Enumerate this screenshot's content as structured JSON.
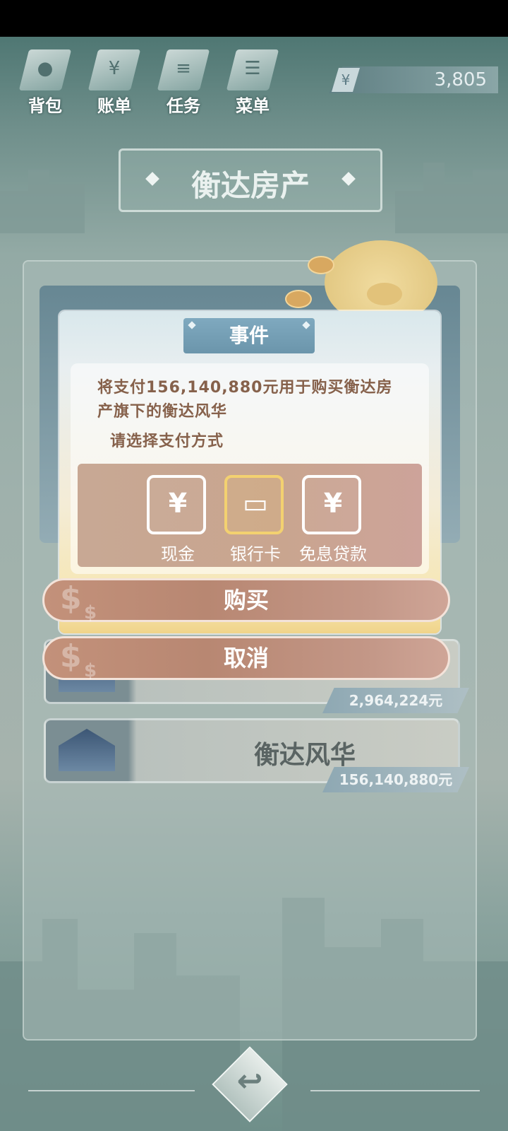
{
  "hud": {
    "items": [
      {
        "label": "背包",
        "icon": "bag-icon"
      },
      {
        "label": "账单",
        "icon": "bill-icon"
      },
      {
        "label": "任务",
        "icon": "task-icon"
      },
      {
        "label": "菜单",
        "icon": "menu-icon"
      }
    ],
    "money": {
      "symbol": "¥",
      "value": "3,805"
    }
  },
  "page": {
    "title": "衡达房产"
  },
  "list": [
    {
      "name": "",
      "price": "2,964,224元"
    },
    {
      "name": "衡达风华",
      "price": "156,140,880元"
    }
  ],
  "modal": {
    "title": "事件",
    "message": "将支付156,140,880元用于购买衡达房产旗下的衡达风华",
    "hint": "请选择支付方式",
    "options": [
      {
        "label": "现金",
        "glyph": "¥",
        "icon": "money-bag-icon",
        "selected": false
      },
      {
        "label": "银行卡",
        "glyph": "▭",
        "icon": "bank-card-icon",
        "selected": true
      },
      {
        "label": "免息贷款",
        "glyph": "¥",
        "icon": "loan-hand-icon",
        "selected": false
      }
    ]
  },
  "buttons": {
    "buy": "购买",
    "cancel": "取消",
    "dollar": "$"
  },
  "nav": {
    "back_glyph": "↩"
  },
  "colors": {
    "accent": "#f3d170",
    "text_brown": "#86614b",
    "button": "#b88772"
  }
}
